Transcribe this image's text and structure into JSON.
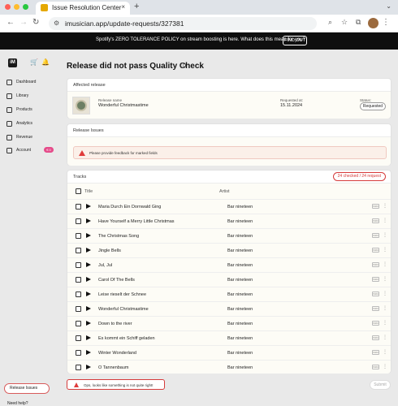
{
  "browser": {
    "tab_title": "Issue Resolution Center",
    "tab_close": "×",
    "new_tab": "+",
    "url": "imusician.app/update-requests/327381",
    "colors": {
      "close": "#ff5f57",
      "minimize": "#febc2e",
      "maximize": "#28c840"
    }
  },
  "banner": {
    "text": "Spotify's ZERO TOLERANCE POLICY on stream boosting is here. What does this mean for you?",
    "button": "FIND OUT"
  },
  "sidebar": {
    "items": [
      {
        "label": "Dashboard",
        "icon": "dashboard-icon"
      },
      {
        "label": "Library",
        "icon": "library-icon"
      },
      {
        "label": "Products",
        "icon": "products-icon"
      },
      {
        "label": "Analytics",
        "icon": "analytics-icon"
      },
      {
        "label": "Revenue",
        "icon": "revenue-icon"
      },
      {
        "label": "Account",
        "icon": "account-icon",
        "badge": "€ 0"
      }
    ],
    "issues_button": "Release Issues",
    "help": "Need help?"
  },
  "page": {
    "title": "Release did not pass Quality Check"
  },
  "affected_release": {
    "heading": "Affected release",
    "release_name_label": "Release name",
    "release_name": "Wonderful Christmastime",
    "requested_label": "Requested at:",
    "requested_at": "15.11.2024",
    "status_label": "Status:",
    "status": "Requested"
  },
  "release_issues": {
    "heading": "Release Issues",
    "alert": "Please provide feedback for marked fields"
  },
  "tracks": {
    "heading": "Tracks",
    "checked": "24 checked / 24 request",
    "col_title": "Title",
    "col_artist": "Artist",
    "tag": "ISRC",
    "more": "⋮",
    "items": [
      {
        "title": "Maria Durch Ein Dornwald Ging",
        "artist": "Bar nineteen"
      },
      {
        "title": "Have Yourself a Merry Little Christmas",
        "artist": "Bar nineteen"
      },
      {
        "title": "The Christmas Song",
        "artist": "Bar nineteen"
      },
      {
        "title": "Jingle Bells",
        "artist": "Bar nineteen"
      },
      {
        "title": "Jul, Jul",
        "artist": "Bar nineteen"
      },
      {
        "title": "Carol Of The Bells",
        "artist": "Bar nineteen"
      },
      {
        "title": "Leise rieselt der Schnee",
        "artist": "Bar nineteen"
      },
      {
        "title": "Wonderful Christmastime",
        "artist": "Bar nineteen"
      },
      {
        "title": "Down to the river",
        "artist": "Bar nineteen"
      },
      {
        "title": "Es kommt ein Schiff geladen",
        "artist": "Bar nineteen"
      },
      {
        "title": "Winter Wonderland",
        "artist": "Bar nineteen"
      },
      {
        "title": "O Tannenbaum",
        "artist": "Bar nineteen"
      }
    ]
  },
  "footer": {
    "error": "Ops, looks like something is not quite right!",
    "submit": "Submit"
  }
}
